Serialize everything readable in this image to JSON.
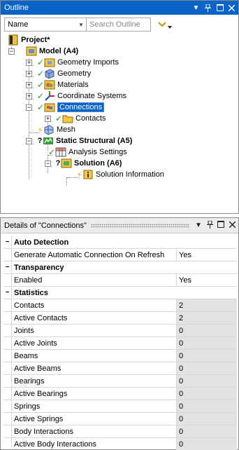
{
  "outline": {
    "title": "Outline",
    "controls": {
      "pin": "↕",
      "max": "□",
      "close": "✕"
    },
    "filter_select": "Name",
    "search_placeholder": "Search Outline",
    "tree": {
      "project": "Project*",
      "model": "Model (A4)",
      "geometry_imports": "Geometry Imports",
      "geometry": "Geometry",
      "materials": "Materials",
      "coordinate_systems": "Coordinate Systems",
      "connections": "Connections",
      "contacts": "Contacts",
      "mesh": "Mesh",
      "static_structural": "Static Structural (A5)",
      "analysis_settings": "Analysis Settings",
      "solution": "Solution (A6)",
      "solution_information": "Solution Information"
    }
  },
  "details": {
    "title": "Details of \"Connections\"",
    "groups": [
      {
        "name": "Auto Detection",
        "rows": [
          {
            "name": "Generate Automatic Connection On Refresh",
            "value": "Yes",
            "readonly": false
          }
        ]
      },
      {
        "name": "Transparency",
        "rows": [
          {
            "name": "Enabled",
            "value": "Yes",
            "readonly": false
          }
        ]
      },
      {
        "name": "Statistics",
        "rows": [
          {
            "name": "Contacts",
            "value": "2",
            "readonly": true
          },
          {
            "name": "Active Contacts",
            "value": "2",
            "readonly": true
          },
          {
            "name": "Joints",
            "value": "0",
            "readonly": true
          },
          {
            "name": "Active Joints",
            "value": "0",
            "readonly": true
          },
          {
            "name": "Beams",
            "value": "0",
            "readonly": true
          },
          {
            "name": "Active Beams",
            "value": "0",
            "readonly": true
          },
          {
            "name": "Bearings",
            "value": "0",
            "readonly": true
          },
          {
            "name": "Active Bearings",
            "value": "0",
            "readonly": true
          },
          {
            "name": "Springs",
            "value": "0",
            "readonly": true
          },
          {
            "name": "Active Springs",
            "value": "0",
            "readonly": true
          },
          {
            "name": "Body Interactions",
            "value": "0",
            "readonly": true
          },
          {
            "name": "Active Body Interactions",
            "value": "0",
            "readonly": true
          }
        ]
      }
    ]
  },
  "colors": {
    "accent": "#0a64c8",
    "check": "#1a9a1a",
    "readonly_bg": "#e3e3e3"
  }
}
